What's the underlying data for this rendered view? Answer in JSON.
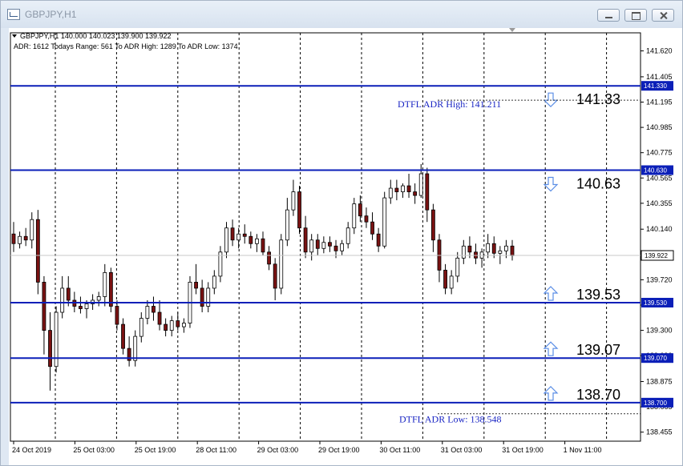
{
  "window": {
    "title": "GBPJPY,H1"
  },
  "info": {
    "ohlc_line": "GBPJPY,H1  140.000 140.023 139.900 139.922",
    "adr_line": "ADR: 1612  Todays Range: 561   To ADR High: 1289   To ADR Low: 1374"
  },
  "colors": {
    "level_line": "#0b1fb8",
    "adr_text": "#1a26c4",
    "arrow": "#5b8ee6",
    "candle_up": "#ffffff",
    "candle_down": "#7a1212",
    "grid": "#000000"
  },
  "chart_data": {
    "type": "candlestick",
    "symbol": "GBPJPY",
    "timeframe": "H1",
    "ylim": [
      138.38,
      141.77
    ],
    "y_ticks": [
      "141.620",
      "141.405",
      "141.195",
      "140.985",
      "140.775",
      "140.565",
      "140.355",
      "140.140",
      "139.930",
      "139.720",
      "139.510",
      "139.300",
      "139.090",
      "138.875",
      "138.665",
      "138.455"
    ],
    "x_ticks": [
      "24 Oct 2019",
      "25 Oct 03:00",
      "25 Oct 19:00",
      "28 Oct 11:00",
      "29 Oct 03:00",
      "29 Oct 19:00",
      "30 Oct 11:00",
      "31 Oct 03:00",
      "31 Oct 19:00",
      "1 Nov 11:00"
    ],
    "current_price": "139.922",
    "levels": [
      {
        "value": 141.33,
        "tag": "141.330",
        "label": "141.33",
        "arrow": "down"
      },
      {
        "value": 140.63,
        "tag": "140.630",
        "label": "140.63",
        "arrow": "down"
      },
      {
        "value": 139.53,
        "tag": "139.530",
        "label": "139.53",
        "arrow": "up"
      },
      {
        "value": 139.07,
        "tag": "139.070",
        "label": "139.07",
        "arrow": "up"
      },
      {
        "value": 138.7,
        "tag": "138.700",
        "label": "138.70",
        "arrow": "up"
      }
    ],
    "adr_high": {
      "value": 141.211,
      "label": "DTFL ADR High: 141.211"
    },
    "adr_low": {
      "value": 138.548,
      "label": "DTFL ADR Low: 138.548"
    },
    "candles": [
      [
        140.1,
        140.2,
        139.95,
        140.02
      ],
      [
        140.02,
        140.12,
        139.98,
        140.08
      ],
      [
        140.08,
        140.15,
        140.0,
        140.05
      ],
      [
        140.05,
        140.28,
        139.98,
        140.22
      ],
      [
        140.22,
        140.3,
        139.6,
        139.7
      ],
      [
        139.7,
        139.75,
        139.1,
        139.3
      ],
      [
        139.3,
        139.45,
        138.8,
        139.0
      ],
      [
        139.0,
        139.5,
        138.95,
        139.45
      ],
      [
        139.45,
        139.75,
        139.4,
        139.65
      ],
      [
        139.65,
        139.75,
        139.5,
        139.55
      ],
      [
        139.55,
        139.62,
        139.45,
        139.5
      ],
      [
        139.5,
        139.58,
        139.44,
        139.48
      ],
      [
        139.48,
        139.55,
        139.4,
        139.52
      ],
      [
        139.52,
        139.6,
        139.47,
        139.55
      ],
      [
        139.55,
        139.62,
        139.5,
        139.58
      ],
      [
        139.58,
        139.85,
        139.5,
        139.78
      ],
      [
        139.78,
        139.82,
        139.45,
        139.5
      ],
      [
        139.5,
        139.55,
        139.3,
        139.35
      ],
      [
        139.35,
        139.4,
        139.1,
        139.15
      ],
      [
        139.15,
        139.25,
        139.0,
        139.05
      ],
      [
        139.05,
        139.3,
        139.0,
        139.25
      ],
      [
        139.25,
        139.45,
        139.2,
        139.4
      ],
      [
        139.4,
        139.55,
        139.35,
        139.5
      ],
      [
        139.5,
        139.58,
        139.38,
        139.45
      ],
      [
        139.45,
        139.55,
        139.3,
        139.35
      ],
      [
        139.35,
        139.4,
        139.25,
        139.3
      ],
      [
        139.3,
        139.42,
        139.25,
        139.38
      ],
      [
        139.38,
        139.45,
        139.3,
        139.33
      ],
      [
        139.33,
        139.4,
        139.28,
        139.36
      ],
      [
        139.36,
        139.75,
        139.32,
        139.7
      ],
      [
        139.7,
        139.85,
        139.6,
        139.65
      ],
      [
        139.65,
        139.72,
        139.45,
        139.5
      ],
      [
        139.5,
        139.7,
        139.45,
        139.65
      ],
      [
        139.65,
        139.8,
        139.6,
        139.75
      ],
      [
        139.75,
        140.0,
        139.7,
        139.95
      ],
      [
        139.95,
        140.2,
        139.9,
        140.15
      ],
      [
        140.15,
        140.22,
        140.0,
        140.05
      ],
      [
        140.05,
        140.15,
        139.98,
        140.1
      ],
      [
        140.1,
        140.18,
        140.02,
        140.08
      ],
      [
        140.08,
        140.12,
        139.98,
        140.02
      ],
      [
        140.02,
        140.1,
        139.95,
        140.06
      ],
      [
        140.06,
        140.12,
        139.92,
        139.95
      ],
      [
        139.95,
        140.0,
        139.8,
        139.85
      ],
      [
        139.85,
        139.9,
        139.55,
        139.65
      ],
      [
        139.65,
        140.1,
        139.6,
        140.05
      ],
      [
        140.05,
        140.4,
        140.0,
        140.3
      ],
      [
        140.3,
        140.55,
        140.25,
        140.45
      ],
      [
        140.45,
        140.5,
        140.1,
        140.15
      ],
      [
        140.15,
        140.25,
        139.9,
        139.95
      ],
      [
        139.95,
        140.1,
        139.88,
        140.05
      ],
      [
        140.05,
        140.1,
        139.92,
        139.98
      ],
      [
        139.98,
        140.08,
        139.94,
        140.03
      ],
      [
        140.03,
        140.08,
        139.95,
        140.0
      ],
      [
        140.0,
        140.05,
        139.9,
        139.96
      ],
      [
        139.96,
        140.05,
        139.92,
        140.02
      ],
      [
        140.02,
        140.2,
        139.98,
        140.15
      ],
      [
        140.15,
        140.4,
        140.1,
        140.35
      ],
      [
        140.35,
        140.42,
        140.2,
        140.25
      ],
      [
        140.25,
        140.32,
        140.15,
        140.2
      ],
      [
        140.2,
        140.28,
        140.05,
        140.1
      ],
      [
        140.1,
        140.15,
        139.95,
        140.0
      ],
      [
        140.0,
        140.45,
        139.98,
        140.4
      ],
      [
        140.4,
        140.55,
        140.35,
        140.48
      ],
      [
        140.48,
        140.55,
        140.38,
        140.45
      ],
      [
        140.45,
        140.52,
        140.4,
        140.5
      ],
      [
        140.5,
        140.6,
        140.4,
        140.45
      ],
      [
        140.45,
        140.52,
        140.35,
        140.42
      ],
      [
        140.42,
        140.68,
        140.4,
        140.6
      ],
      [
        140.6,
        140.65,
        140.2,
        140.3
      ],
      [
        140.3,
        140.35,
        139.95,
        140.05
      ],
      [
        140.05,
        140.1,
        139.7,
        139.8
      ],
      [
        139.8,
        139.85,
        139.6,
        139.65
      ],
      [
        139.65,
        139.8,
        139.6,
        139.75
      ],
      [
        139.75,
        139.95,
        139.7,
        139.9
      ],
      [
        139.9,
        140.05,
        139.85,
        140.0
      ],
      [
        140.0,
        140.08,
        139.9,
        139.95
      ],
      [
        139.95,
        140.02,
        139.85,
        139.9
      ],
      [
        139.9,
        139.98,
        139.82,
        139.95
      ],
      [
        139.95,
        140.1,
        139.9,
        140.02
      ],
      [
        140.02,
        140.08,
        139.9,
        139.94
      ],
      [
        139.94,
        140.0,
        139.85,
        139.96
      ],
      [
        139.96,
        140.05,
        139.9,
        140.0
      ],
      [
        140.0,
        140.05,
        139.88,
        139.92
      ]
    ]
  }
}
